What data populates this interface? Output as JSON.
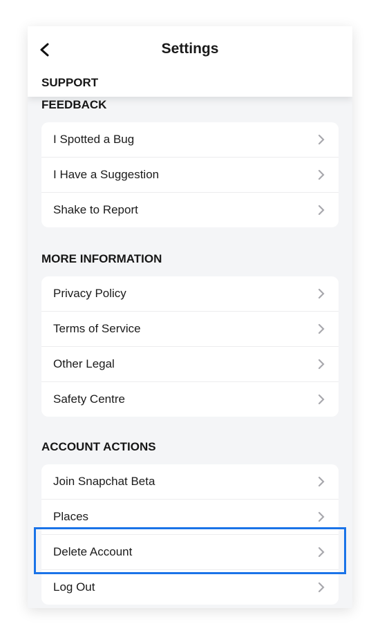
{
  "header": {
    "title": "Settings",
    "back_icon": "chevron-left-icon"
  },
  "support_label": "SUPPORT",
  "sections": [
    {
      "title": "FEEDBACK",
      "items": [
        "I Spotted a Bug",
        "I Have a Suggestion",
        "Shake to Report"
      ]
    },
    {
      "title": "MORE INFORMATION",
      "items": [
        "Privacy Policy",
        "Terms of Service",
        "Other Legal",
        "Safety Centre"
      ]
    },
    {
      "title": "ACCOUNT ACTIONS",
      "items": [
        "Join Snapchat Beta",
        "Places",
        "Delete Account",
        "Log Out"
      ]
    }
  ],
  "highlight_color": "#1a73e8",
  "highlighted_item": "Delete Account"
}
